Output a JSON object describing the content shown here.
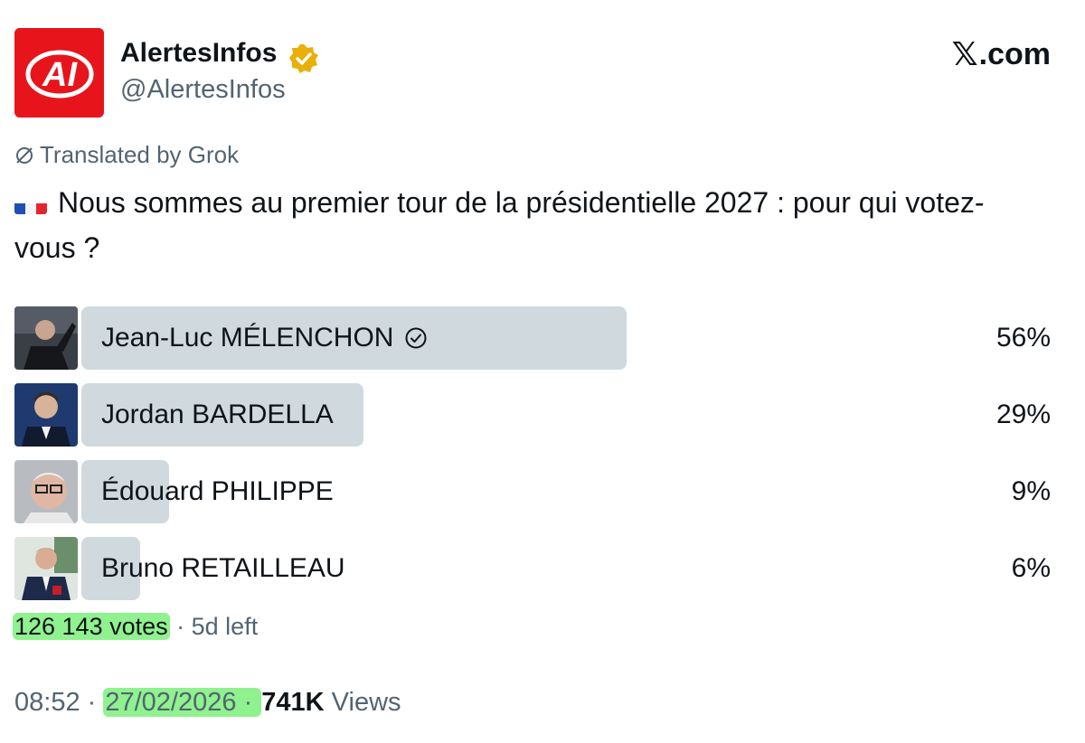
{
  "account": {
    "avatar_text": "AI",
    "display_name": "AlertesInfos",
    "handle": "@AlertesInfos",
    "verified_color": "#e8b008"
  },
  "brand": {
    "x": "𝕏",
    "domain": ".com"
  },
  "translation_note": "Translated by Grok",
  "tweet": {
    "flag": "france-flag-icon",
    "text": "Nous sommes au premier tour de la présidentielle 2027 : pour qui votez-vous ?"
  },
  "poll": {
    "options": [
      {
        "label": "Jean-Luc MÉLENCHON",
        "percent": "56%",
        "share": 0.56,
        "selected": true
      },
      {
        "label": "Jordan BARDELLA",
        "percent": "29%",
        "share": 0.29,
        "selected": false
      },
      {
        "label": "Édouard PHILIPPE",
        "percent": "9%",
        "share": 0.09,
        "selected": false
      },
      {
        "label": "Bruno RETAILLEAU",
        "percent": "6%",
        "share": 0.06,
        "selected": false
      }
    ],
    "votes": "126 143 votes",
    "separator": " · ",
    "time_left": "5d left"
  },
  "meta": {
    "time": "08:52",
    "sep1": " · ",
    "date": "27/02/2026",
    "sep2": " · ",
    "views_count": "741K",
    "views_label": " Views"
  },
  "colors": {
    "accent_red": "#e8141c",
    "bar": "#cfd9de",
    "highlight": "#8ff28f",
    "muted": "#536471"
  }
}
